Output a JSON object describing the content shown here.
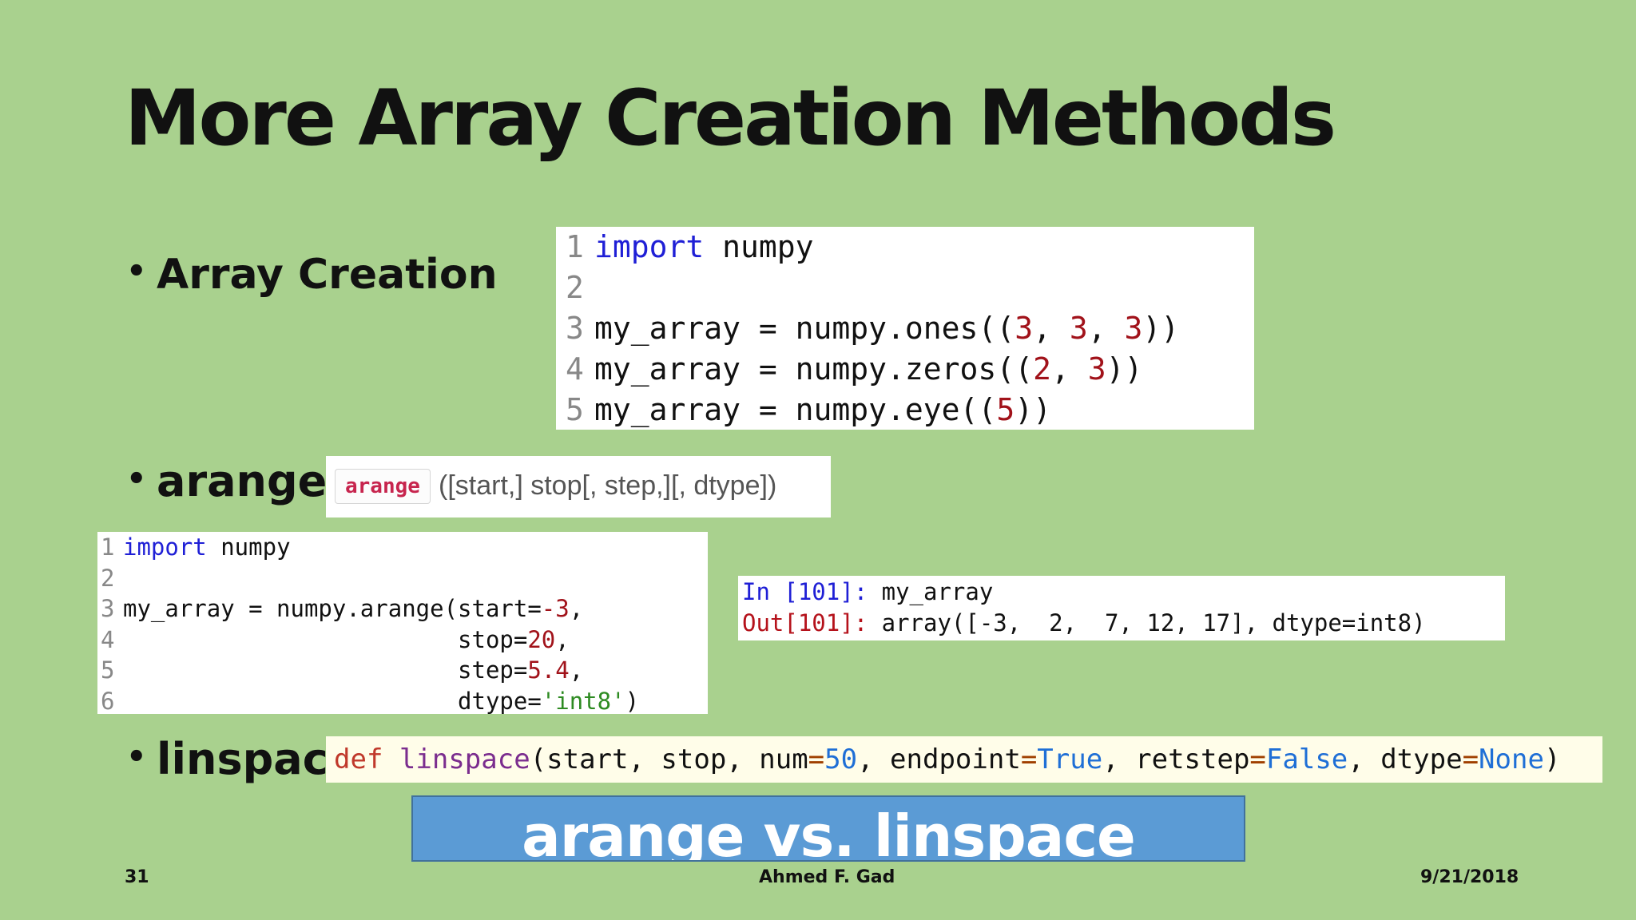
{
  "slide": {
    "title": "More Array Creation Methods",
    "bullets": {
      "array_creation": "Array Creation",
      "arange": "arange",
      "linspace": "linspace"
    },
    "bullet_glyph": "•"
  },
  "code_block_1": {
    "lines": [
      {
        "num": "1",
        "parts": [
          {
            "t": "import",
            "c": "kw"
          },
          {
            "t": " numpy",
            "c": ""
          }
        ]
      },
      {
        "num": "2",
        "parts": []
      },
      {
        "num": "3",
        "parts": [
          {
            "t": "my_array = numpy.ones((",
            "c": ""
          },
          {
            "t": "3",
            "c": "num"
          },
          {
            "t": ", ",
            "c": ""
          },
          {
            "t": "3",
            "c": "num"
          },
          {
            "t": ", ",
            "c": ""
          },
          {
            "t": "3",
            "c": "num"
          },
          {
            "t": "))",
            "c": ""
          }
        ]
      },
      {
        "num": "4",
        "parts": [
          {
            "t": "my_array = numpy.zeros((",
            "c": ""
          },
          {
            "t": "2",
            "c": "num"
          },
          {
            "t": ", ",
            "c": ""
          },
          {
            "t": "3",
            "c": "num"
          },
          {
            "t": "))",
            "c": ""
          }
        ]
      },
      {
        "num": "5",
        "parts": [
          {
            "t": "my_array = numpy.eye((",
            "c": ""
          },
          {
            "t": "5",
            "c": "num"
          },
          {
            "t": "))",
            "c": ""
          }
        ]
      }
    ]
  },
  "arange_signature": {
    "name": "arange",
    "params": "([start,] stop[, step,][, dtype])"
  },
  "code_block_2": {
    "lines": [
      {
        "num": "1",
        "parts": [
          {
            "t": "import",
            "c": "kw"
          },
          {
            "t": " numpy",
            "c": ""
          }
        ]
      },
      {
        "num": "2",
        "parts": []
      },
      {
        "num": "3",
        "parts": [
          {
            "t": "my_array = numpy.arange(start=",
            "c": ""
          },
          {
            "t": "-3",
            "c": "num"
          },
          {
            "t": ",",
            "c": ""
          }
        ]
      },
      {
        "num": "4",
        "parts": [
          {
            "t": "                        stop=",
            "c": ""
          },
          {
            "t": "20",
            "c": "num"
          },
          {
            "t": ",",
            "c": ""
          }
        ]
      },
      {
        "num": "5",
        "parts": [
          {
            "t": "                        step=",
            "c": ""
          },
          {
            "t": "5.4",
            "c": "num"
          },
          {
            "t": ",",
            "c": ""
          }
        ]
      },
      {
        "num": "6",
        "parts": [
          {
            "t": "                        dtype=",
            "c": ""
          },
          {
            "t": "'int8'",
            "c": "str"
          },
          {
            "t": ")",
            "c": ""
          }
        ]
      }
    ]
  },
  "console_output": {
    "lines": [
      {
        "parts": [
          {
            "t": "In [",
            "c": "blue"
          },
          {
            "t": "101",
            "c": "blue"
          },
          {
            "t": "]: ",
            "c": "blue"
          },
          {
            "t": "my_array",
            "c": ""
          }
        ]
      },
      {
        "parts": [
          {
            "t": "Out[",
            "c": "red"
          },
          {
            "t": "101",
            "c": "red"
          },
          {
            "t": "]: ",
            "c": "red"
          },
          {
            "t": "array([-3,  2,  7, 12, 17], dtype=int8)",
            "c": ""
          }
        ]
      }
    ]
  },
  "linspace_signature": {
    "parts": [
      {
        "t": "def",
        "c": "def"
      },
      {
        "t": " ",
        "c": ""
      },
      {
        "t": "linspace",
        "c": "fn"
      },
      {
        "t": "(start, stop, num",
        "c": ""
      },
      {
        "t": "=",
        "c": "op"
      },
      {
        "t": "50",
        "c": "const"
      },
      {
        "t": ", endpoint",
        "c": ""
      },
      {
        "t": "=",
        "c": "op"
      },
      {
        "t": "True",
        "c": "const"
      },
      {
        "t": ", retstep",
        "c": ""
      },
      {
        "t": "=",
        "c": "op"
      },
      {
        "t": "False",
        "c": "const"
      },
      {
        "t": ", dtype",
        "c": ""
      },
      {
        "t": "=",
        "c": "op"
      },
      {
        "t": "None",
        "c": "const"
      },
      {
        "t": ")",
        "c": ""
      }
    ]
  },
  "banner": {
    "text": "arange vs. linspace",
    "background": "#5b9bd5"
  },
  "footer": {
    "slide_number": "31",
    "author": "Ahmed F. Gad",
    "date": "9/21/2018"
  },
  "colors": {
    "background": "#a9d18e",
    "keyword": "#1f1fd6",
    "number": "#a1121a",
    "string": "#2e8b22"
  }
}
